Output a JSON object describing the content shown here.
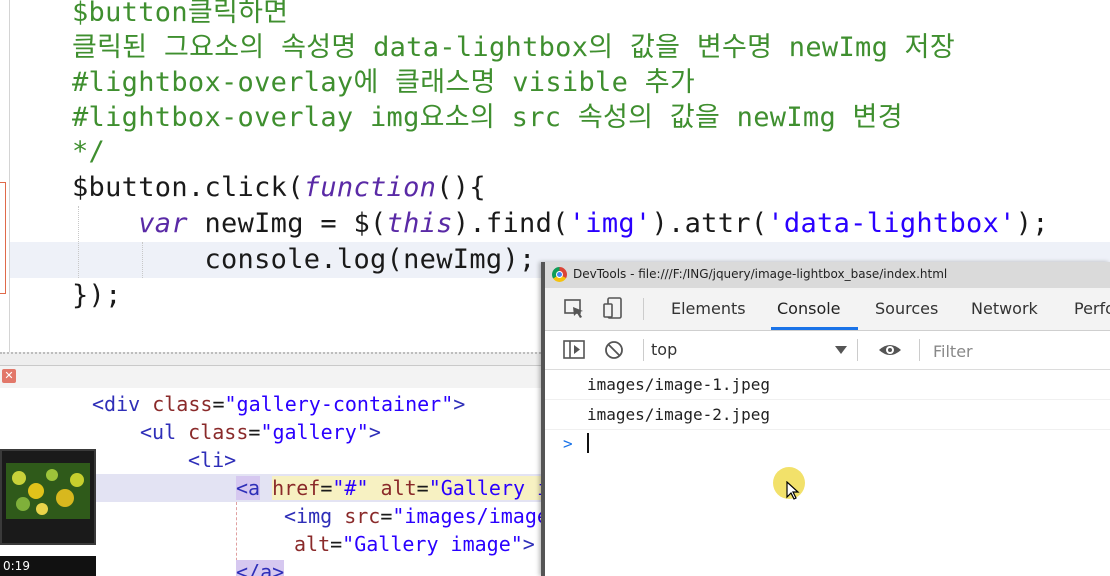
{
  "code": [
    [
      {
        "c": "cm",
        "t": "$button클릭하면"
      }
    ],
    [
      {
        "c": "cm",
        "t": "클릭된 그요소의 속성명 data-lightbox의 값을 변수명 newImg 저장"
      }
    ],
    [
      {
        "c": "cm",
        "t": "#lightbox-overlay에 클래스명 visible 추가"
      }
    ],
    [
      {
        "c": "cm",
        "t": "#lightbox-overlay img요소의 src 속성의 값을 newImg 변경"
      }
    ],
    [
      {
        "c": "cm",
        "t": "*/"
      }
    ],
    [
      {
        "c": "plain",
        "t": "$button.click("
      },
      {
        "c": "kw",
        "t": "function"
      },
      {
        "c": "plain",
        "t": "(){"
      }
    ],
    [
      {
        "c": "plain",
        "t": "    "
      },
      {
        "c": "kw",
        "t": "var"
      },
      {
        "c": "plain",
        "t": " newImg = $("
      },
      {
        "c": "kw",
        "t": "this"
      },
      {
        "c": "plain",
        "t": ").find("
      },
      {
        "c": "str",
        "t": "'img'"
      },
      {
        "c": "plain",
        "t": ").attr("
      },
      {
        "c": "str",
        "t": "'data-lightbox'"
      },
      {
        "c": "plain",
        "t": ");"
      }
    ],
    [
      {
        "c": "plain",
        "t": "        console.log(newImg);"
      }
    ],
    [
      {
        "c": "plain",
        "t": "});"
      }
    ]
  ],
  "html_code": [
    [
      {
        "c": "tag",
        "t": "<div "
      },
      {
        "c": "attr",
        "t": "class"
      },
      {
        "c": "txt",
        "t": "="
      },
      {
        "c": "val",
        "t": "\"gallery-container\""
      },
      {
        "c": "tag",
        "t": ">"
      }
    ],
    [
      {
        "c": "tag",
        "t": "<ul "
      },
      {
        "c": "attr",
        "t": "class"
      },
      {
        "c": "txt",
        "t": "="
      },
      {
        "c": "val",
        "t": "\"gallery\""
      },
      {
        "c": "tag",
        "t": ">"
      }
    ],
    [
      {
        "c": "tag",
        "t": "<li>"
      }
    ],
    [
      {
        "c": "tag hl-tag",
        "t": "<a"
      },
      {
        "c": "txt",
        "t": " "
      },
      {
        "c": "attr hl-attr",
        "t": "href"
      },
      {
        "c": "txt hl-attr",
        "t": "="
      },
      {
        "c": "val hl-attr",
        "t": "\"#\""
      },
      {
        "c": "txt hl-attr",
        "t": " "
      },
      {
        "c": "attr hl-attr",
        "t": "alt"
      },
      {
        "c": "txt hl-attr",
        "t": "="
      },
      {
        "c": "val hl-attr",
        "t": "\"Gallery i"
      }
    ],
    [
      {
        "c": "tag",
        "t": "<img "
      },
      {
        "c": "attr",
        "t": "src"
      },
      {
        "c": "txt",
        "t": "="
      },
      {
        "c": "val",
        "t": "\"images/image"
      }
    ],
    [
      {
        "c": "attr",
        "t": "alt"
      },
      {
        "c": "txt",
        "t": "="
      },
      {
        "c": "val",
        "t": "\"Gallery image\""
      },
      {
        "c": "tag",
        "t": ">"
      }
    ],
    [
      {
        "c": "tag hl-tag",
        "t": "</a>"
      }
    ]
  ],
  "video": {
    "timestamp": "0:19"
  },
  "devtools": {
    "window_title": "DevTools - file:///F:/ING/jquery/image-lightbox_base/index.html",
    "tabs": [
      "Elements",
      "Console",
      "Sources",
      "Network",
      "Perfo"
    ],
    "active_tab": "Console",
    "context": "top",
    "filter_placeholder": "Filter",
    "logs": [
      "images/image-1.jpeg",
      "images/image-2.jpeg"
    ],
    "prompt": ">",
    "accent": "#1a73e8"
  }
}
